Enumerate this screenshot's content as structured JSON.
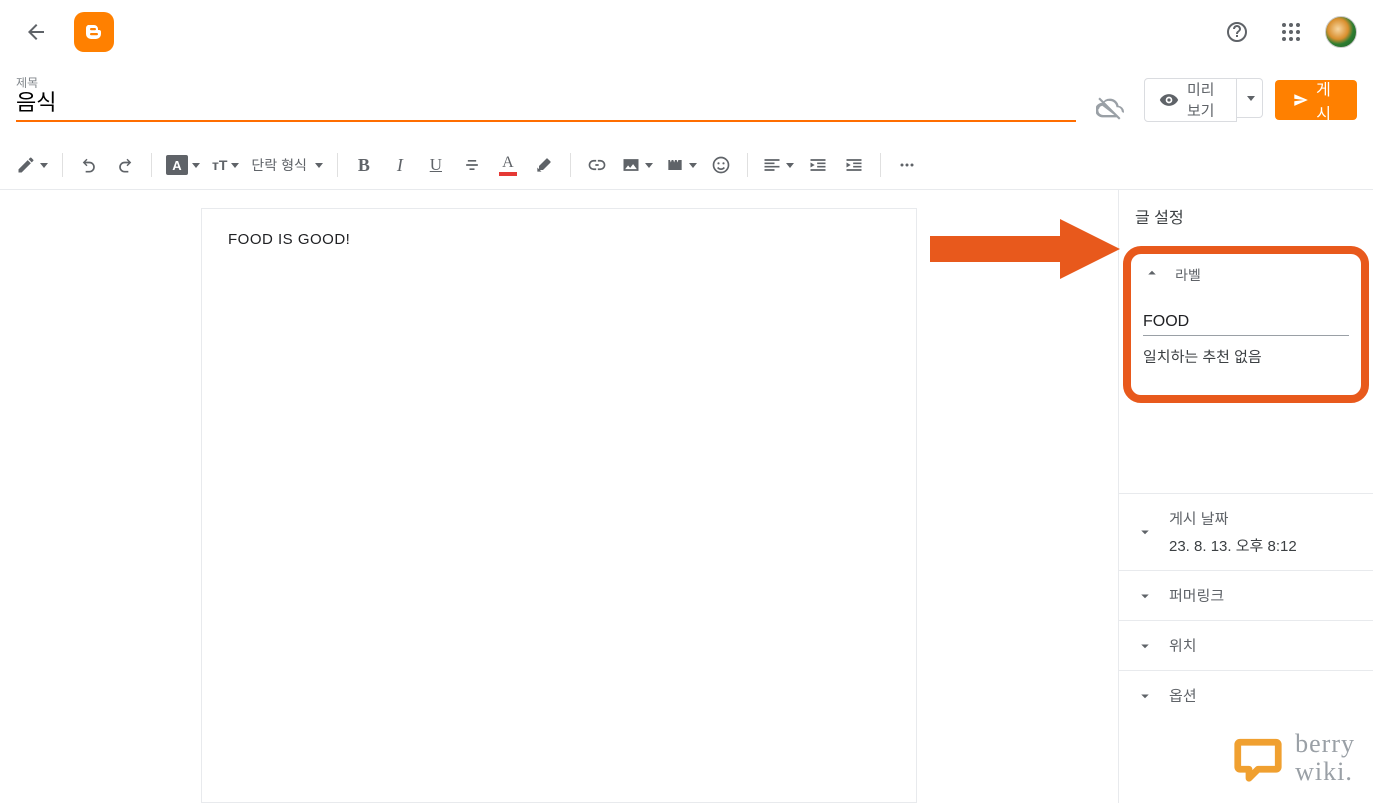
{
  "header": {
    "title_label": "제목",
    "title_value": "음식",
    "preview_label": "미리보기",
    "publish_label": "게시"
  },
  "toolbar": {
    "paragraph_format": "단락 형식",
    "text_bg_glyph": "A",
    "font_size_glyph": "ᴛT",
    "bold": "B",
    "italic": "I",
    "underline": "U",
    "text_color_glyph": "A"
  },
  "editor": {
    "content": "FOOD IS GOOD!"
  },
  "sidebar": {
    "title": "글 설정",
    "labels_section": {
      "header": "라벨",
      "input_value": "FOOD",
      "nomatch": "일치하는 추천 없음"
    },
    "panels": {
      "publish_date_label": "게시 날짜",
      "publish_date_value": "23. 8. 13. 오후 8:12",
      "permalink": "퍼머링크",
      "location": "위치",
      "options": "옵션"
    }
  },
  "watermark": {
    "line1": "berry",
    "line2": "wiki."
  }
}
